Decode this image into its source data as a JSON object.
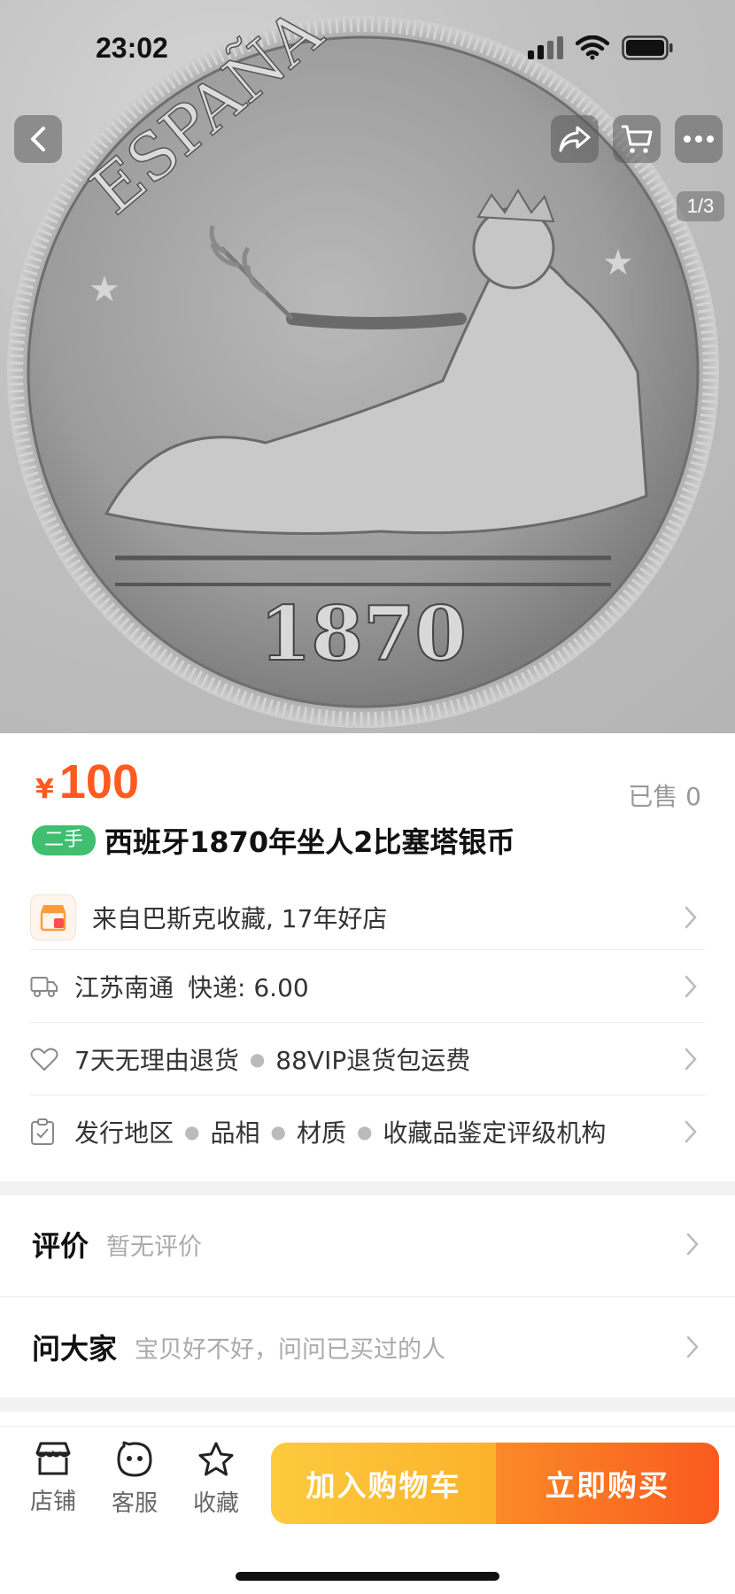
{
  "status_bar": {
    "time": "23:02"
  },
  "gallery": {
    "indicator": "1/3"
  },
  "coin_inscriptions": {
    "country": "ESPAÑA",
    "year": "1870"
  },
  "product": {
    "price_symbol": "¥",
    "price": "100",
    "sold": "已售 0",
    "condition_tag": "二手",
    "title": "西班牙1870年坐人2比塞塔银币"
  },
  "shop_row": {
    "text": "来自巴斯克收藏, 17年好店"
  },
  "shipping_row": {
    "origin": "江苏南通",
    "method": "快递: 6.00"
  },
  "service_row": {
    "item1": "7天无理由退货",
    "item2": "88VIP退货包运费"
  },
  "params_row": {
    "items": [
      "发行地区",
      "品相",
      "材质",
      "收藏品鉴定评级机构"
    ]
  },
  "reviews": {
    "title": "评价",
    "sub": "暂无评价"
  },
  "qa": {
    "title": "问大家",
    "sub": "宝贝好不好，问问已买过的人"
  },
  "bottom_bar": {
    "shop_label": "店铺",
    "service_label": "客服",
    "favorite_label": "收藏",
    "add_cart_label": "加入购物车",
    "buy_now_label": "立即购买"
  },
  "colors": {
    "price": "#ff5a1f",
    "tag_green": "#3fbf6f",
    "cart_btn": "#fdca3e",
    "buy_btn": "#f95a1e"
  },
  "icons": [
    "back-icon",
    "share-icon",
    "cart-icon",
    "more-icon",
    "shop-icon",
    "truck-icon",
    "heart-icon",
    "clipboard-icon",
    "store-icon",
    "service-face-icon",
    "star-icon",
    "chevron-right-icon"
  ]
}
